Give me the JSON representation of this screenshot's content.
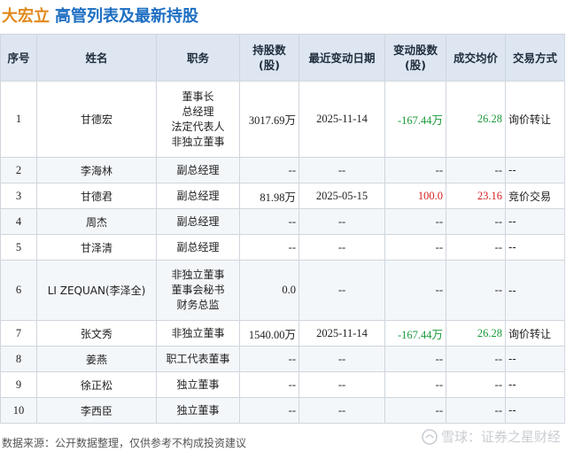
{
  "header": {
    "company": "大宏立",
    "title": "高管列表及最新持股"
  },
  "table": {
    "columns": [
      "序号",
      "姓名",
      "职务",
      "持股数\n(股)",
      "最近变动日期",
      "变动股数\n(股)",
      "成交均价",
      "交易方式"
    ],
    "rows": [
      {
        "no": "1",
        "name": "甘德宏",
        "roles": [
          "董事长",
          "总经理",
          "法定代表人",
          "非独立董事"
        ],
        "shares": "3017.69万",
        "date": "2025-11-14",
        "change": "-167.44万",
        "change_sign": "neg",
        "price": "26.28",
        "price_sign": "neg",
        "method": "询价转让"
      },
      {
        "no": "2",
        "name": "李海林",
        "roles": [
          "副总经理"
        ],
        "shares": "--",
        "date": "--",
        "change": "--",
        "change_sign": "",
        "price": "--",
        "price_sign": "",
        "method": "--"
      },
      {
        "no": "3",
        "name": "甘德君",
        "roles": [
          "副总经理"
        ],
        "shares": "81.98万",
        "date": "2025-05-15",
        "change": "100.0",
        "change_sign": "pos",
        "price": "23.16",
        "price_sign": "pos",
        "method": "竞价交易"
      },
      {
        "no": "4",
        "name": "周杰",
        "roles": [
          "副总经理"
        ],
        "shares": "--",
        "date": "--",
        "change": "--",
        "change_sign": "",
        "price": "--",
        "price_sign": "",
        "method": "--"
      },
      {
        "no": "5",
        "name": "甘泽清",
        "roles": [
          "副总经理"
        ],
        "shares": "--",
        "date": "--",
        "change": "--",
        "change_sign": "",
        "price": "--",
        "price_sign": "",
        "method": "--"
      },
      {
        "no": "6",
        "name": "LI ZEQUAN(李泽全)",
        "roles": [
          "非独立董事",
          "董事会秘书",
          "财务总监"
        ],
        "shares": "0.0",
        "date": "--",
        "change": "--",
        "change_sign": "",
        "price": "--",
        "price_sign": "",
        "method": "--"
      },
      {
        "no": "7",
        "name": "张文秀",
        "roles": [
          "非独立董事"
        ],
        "shares": "1540.00万",
        "date": "2025-11-14",
        "change": "-167.44万",
        "change_sign": "neg",
        "price": "26.28",
        "price_sign": "neg",
        "method": "询价转让"
      },
      {
        "no": "8",
        "name": "姜燕",
        "roles": [
          "职工代表董事"
        ],
        "shares": "--",
        "date": "--",
        "change": "--",
        "change_sign": "",
        "price": "--",
        "price_sign": "",
        "method": "--"
      },
      {
        "no": "9",
        "name": "徐正松",
        "roles": [
          "独立董事"
        ],
        "shares": "--",
        "date": "--",
        "change": "--",
        "change_sign": "",
        "price": "--",
        "price_sign": "",
        "method": "--"
      },
      {
        "no": "10",
        "name": "李西臣",
        "roles": [
          "独立董事"
        ],
        "shares": "--",
        "date": "--",
        "change": "--",
        "change_sign": "",
        "price": "--",
        "price_sign": "",
        "method": "--"
      }
    ]
  },
  "footer": {
    "source": "数据来源：公开数据整理，仅供参考不构成投资建议",
    "brand": "雪球：证券之星财经"
  },
  "watermark": {
    "text": "证券之星"
  },
  "colors": {
    "company": "#e08a1e",
    "title": "#1d6ec2",
    "positive": "#d81e1e",
    "negative": "#1a9a3a",
    "header_bg": "#dde6f1"
  }
}
